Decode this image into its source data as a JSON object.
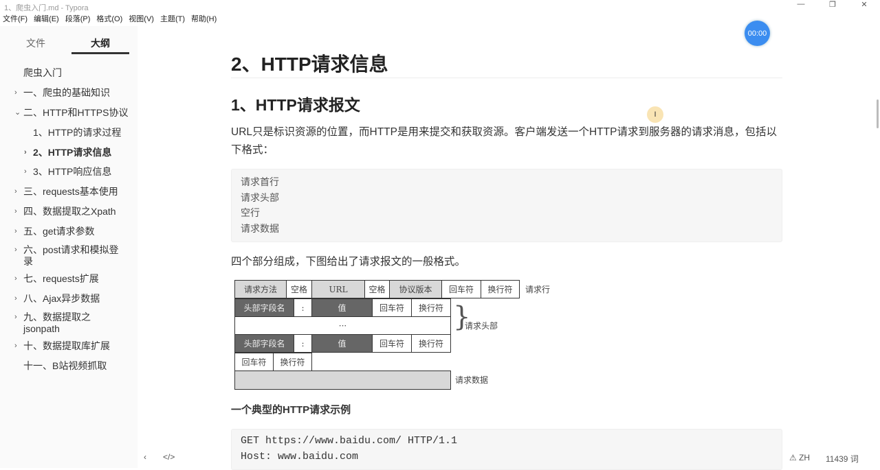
{
  "window": {
    "title": "1、爬虫入门.md - Typora",
    "controls": [
      "—",
      "❐",
      "✕"
    ]
  },
  "menu": [
    "文件(F)",
    "编辑(E)",
    "段落(P)",
    "格式(O)",
    "视图(V)",
    "主题(T)",
    "帮助(H)"
  ],
  "sidebar": {
    "tabs": [
      "文件",
      "大纲"
    ],
    "outline": [
      {
        "label": "爬虫入门",
        "arrow": ""
      },
      {
        "label": "一、爬虫的基础知识",
        "arrow": "›"
      },
      {
        "label": "二、HTTP和HTTPS协议",
        "arrow": "⌄"
      },
      {
        "label": "1、HTTP的请求过程",
        "arrow": ""
      },
      {
        "label": "2、HTTP请求信息",
        "arrow": "›"
      },
      {
        "label": "3、HTTP响应信息",
        "arrow": "›"
      },
      {
        "label": "三、requests基本使用",
        "arrow": "›"
      },
      {
        "label": "四、数据提取之Xpath",
        "arrow": "›"
      },
      {
        "label": "五、get请求参数",
        "arrow": "›"
      },
      {
        "label": "六、post请求和模拟登录",
        "arrow": "›"
      },
      {
        "label": "七、requests扩展",
        "arrow": "›"
      },
      {
        "label": "八、Ajax异步数据",
        "arrow": "›"
      },
      {
        "label": "九、数据提取之jsonpath",
        "arrow": "›"
      },
      {
        "label": "十、数据提取库扩展",
        "arrow": "›"
      },
      {
        "label": "十一、B站视频抓取",
        "arrow": ""
      }
    ]
  },
  "doc": {
    "h1": "2、HTTP请求信息",
    "h2": "1、HTTP请求报文",
    "p1": "URL只是标识资源的位置，而HTTP是用来提交和获取资源。客户端发送一个HTTP请求到服务器的请求消息，包括以下格式：",
    "code1": [
      "请求首行",
      "请求头部",
      "空行",
      "请求数据"
    ],
    "p2": "四个部分组成，下图给出了请求报文的一般格式。",
    "diagram": {
      "method": "请求方法",
      "space": "空格",
      "url": "URL",
      "version": "协议版本",
      "cr": "回车符",
      "lf": "换行符",
      "req_line": "请求行",
      "field": "头部字段名",
      "colon": ":",
      "value": "值",
      "dots": "···",
      "req_header": "请求头部",
      "req_data": "请求数据"
    },
    "h4": "一个典型的HTTP请求示例",
    "code2": [
      "GET https://www.baidu.com/ HTTP/1.1",
      "Host: www.baidu.com"
    ]
  },
  "timer": "00:00",
  "status": {
    "lang": "ZH",
    "words": "11439 词"
  }
}
